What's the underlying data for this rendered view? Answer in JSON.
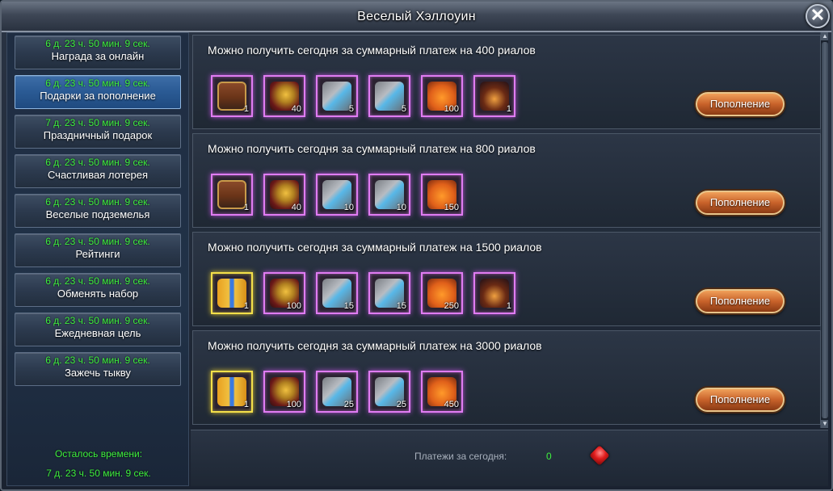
{
  "window": {
    "title": "Веселый Хэллоуин"
  },
  "sidebar": {
    "items": [
      {
        "timer": "6 д. 23 ч. 50 мин. 9 сек.",
        "label": "Награда за онлайн"
      },
      {
        "timer": "6 д. 23 ч. 50 мин. 9 сек.",
        "label": "Подарки за пополнение"
      },
      {
        "timer": "7 д. 23 ч. 50 мин. 9 сек.",
        "label": "Праздничный подарок"
      },
      {
        "timer": "6 д. 23 ч. 50 мин. 9 сек.",
        "label": "Счастливая лотерея"
      },
      {
        "timer": "6 д. 23 ч. 50 мин. 9 сек.",
        "label": "Веселые подземелья"
      },
      {
        "timer": "6 д. 23 ч. 50 мин. 9 сек.",
        "label": "Рейтинги"
      },
      {
        "timer": "6 д. 23 ч. 50 мин. 9 сек.",
        "label": "Обменять набор"
      },
      {
        "timer": "6 д. 23 ч. 50 мин. 9 сек.",
        "label": "Ежедневная цель"
      },
      {
        "timer": "6 д. 23 ч. 50 мин. 9 сек.",
        "label": "Зажечь тыкву"
      }
    ],
    "active_label": "Подарки за пополнение",
    "remaining_label": "Осталось времени:",
    "remaining_value": "7 д. 23 ч. 50 мин. 9 сек."
  },
  "tiers": [
    {
      "title": "Можно получить сегодня за суммарный платеж на 400 риалов",
      "button": "Пополнение",
      "items": [
        {
          "icon": "treasure-chest-icon",
          "qty": "1"
        },
        {
          "icon": "golden-key-icon",
          "qty": "40"
        },
        {
          "icon": "puzzle-piece-icon",
          "qty": "5"
        },
        {
          "icon": "puzzle-piece-icon",
          "qty": "5"
        },
        {
          "icon": "pumpkin-icon",
          "qty": "100"
        },
        {
          "icon": "witch-hat-icon",
          "qty": "1"
        }
      ]
    },
    {
      "title": "Можно получить сегодня за суммарный платеж на 800 риалов",
      "button": "Пополнение",
      "items": [
        {
          "icon": "treasure-chest-icon",
          "qty": "1"
        },
        {
          "icon": "golden-key-icon",
          "qty": "40"
        },
        {
          "icon": "puzzle-piece-icon",
          "qty": "10"
        },
        {
          "icon": "puzzle-piece-icon",
          "qty": "10"
        },
        {
          "icon": "pumpkin-icon",
          "qty": "150"
        }
      ]
    },
    {
      "title": "Можно получить сегодня за суммарный платеж на 1500 риалов",
      "button": "Пополнение",
      "items": [
        {
          "icon": "gift-box-icon",
          "qty": "1"
        },
        {
          "icon": "golden-key-icon",
          "qty": "100"
        },
        {
          "icon": "puzzle-piece-icon",
          "qty": "15"
        },
        {
          "icon": "puzzle-piece-icon",
          "qty": "15"
        },
        {
          "icon": "pumpkin-icon",
          "qty": "250"
        },
        {
          "icon": "witch-hat-icon",
          "qty": "1"
        }
      ]
    },
    {
      "title": "Можно получить сегодня за суммарный платеж на 3000 риалов",
      "button": "Пополнение",
      "items": [
        {
          "icon": "gift-box-icon",
          "qty": "1"
        },
        {
          "icon": "golden-key-icon",
          "qty": "100"
        },
        {
          "icon": "puzzle-piece-icon",
          "qty": "25"
        },
        {
          "icon": "puzzle-piece-icon",
          "qty": "25"
        },
        {
          "icon": "pumpkin-icon",
          "qty": "450"
        }
      ]
    }
  ],
  "footer": {
    "payments_label": "Платежи за сегодня:",
    "payments_value": "0",
    "currency_icon": "ruby-icon"
  },
  "colors": {
    "timer_green": "#3ef03e",
    "active_tab": "#2a5a94",
    "item_border_purple": "#e07cf2",
    "item_border_gold": "#f4e04a",
    "button_orange": "#c8622a"
  }
}
